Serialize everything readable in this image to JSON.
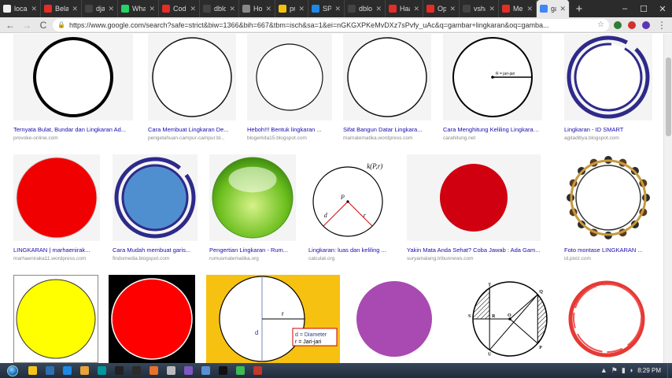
{
  "browser": {
    "tabs": [
      {
        "title": "localho",
        "color": "#f0f0f0"
      },
      {
        "title": "Belajar",
        "color": "#e52d27"
      },
      {
        "title": "django",
        "color": "#444444"
      },
      {
        "title": "Whats",
        "color": "#25d366"
      },
      {
        "title": "Coding",
        "color": "#e52d27"
      },
      {
        "title": "dbloisi",
        "color": "#444444"
      },
      {
        "title": "How to",
        "color": "#888888"
      },
      {
        "title": "profs.",
        "color": "#f4c20d"
      },
      {
        "title": "SPQR",
        "color": "#1e88e5"
      },
      {
        "title": "dbloisi",
        "color": "#444444"
      },
      {
        "title": "Haar C",
        "color": "#e52d27"
      },
      {
        "title": "OpenC",
        "color": "#e52d27"
      },
      {
        "title": "vshant",
        "color": "#444444"
      },
      {
        "title": "Mende",
        "color": "#e52d27"
      },
      {
        "title": "gar",
        "color": "#4285f4",
        "active": true
      }
    ],
    "new_tab_label": "+",
    "window_controls": {
      "minimize": "–",
      "maximize": "☐",
      "close": "✕"
    },
    "nav": {
      "back": "←",
      "forward": "→",
      "reload": "C",
      "home": "⌂"
    },
    "url": "https://www.google.com/search?safe=strict&biw=1366&bih=667&tbm=isch&sa=1&ei=nGKGXPKeMvDXz7sPvfy_uAc&q=gambar+lingkaran&oq=gamba...",
    "star_icon": "☆",
    "extension_colors": [
      "#2e7d32",
      "#d32f2f",
      "#5e35b1"
    ]
  },
  "results": [
    {
      "title": "Ternyata Bulat, Bundar dan Lingkaran Ad...",
      "source": "provoke-online.com",
      "art": "thick-ring"
    },
    {
      "title": "Cara Membuat Lingkaran De...",
      "source": "pengetahuan-campur-campur.bl...",
      "art": "thin-ring"
    },
    {
      "title": "Heboh!!! Bentuk lingkaran ...",
      "source": "blogerkita15.blogspot.com",
      "art": "thin-ring-small"
    },
    {
      "title": "Sifat Bangun Datar Lingkara...",
      "source": "mamatematika.wordpress.com",
      "art": "thin-ring"
    },
    {
      "title": "Cara Menghitung Keliling Lingkaran ...",
      "source": "carahitung.net",
      "art": "radius-circle",
      "label": "R = jari-jari"
    },
    {
      "title": "Lingkaran - ID SMART",
      "source": "agitaditiya.blogspot.com",
      "art": "navy-ring"
    },
    {
      "title": "LINGKARAN | marhaenirak...",
      "source": "marhaeniraka11.wordpress.com",
      "art": "red-disc"
    },
    {
      "title": "Cara Mudah membuat garis...",
      "source": "findomedia.blogspot.com",
      "art": "blue-disc-ring"
    },
    {
      "title": "Pengertian Lingkaran - Rum...",
      "source": "rumusmatematika.org",
      "art": "green-ball"
    },
    {
      "title": "Lingkaran: luas dan keliling ...",
      "source": "calculat.org",
      "art": "kpr-circle",
      "labels": [
        "k(P,r)",
        "P",
        "d",
        "r"
      ]
    },
    {
      "title": "Yakin Mata Anda Sehat? Coba Jawab : Ada Gam...",
      "source": "suryamalang.tribunnews.com",
      "art": "red-disc-dark"
    },
    {
      "title": "Foto montase LINGKARAN ...",
      "source": "id.pixiz.com",
      "art": "ornate-frame"
    },
    {
      "title": "",
      "source": "",
      "art": "yellow-disc"
    },
    {
      "title": "",
      "source": "",
      "art": "red-on-black"
    },
    {
      "title": "",
      "source": "",
      "art": "diameter-diagram",
      "labels": [
        "r",
        "d",
        "d = Diameter",
        "r = Jari-jari"
      ]
    },
    {
      "title": "",
      "source": "",
      "art": "purple-disc"
    },
    {
      "title": "",
      "source": "",
      "art": "parts-diagram",
      "labels": [
        "T",
        "Q",
        "S",
        "R",
        "O",
        "U",
        "P"
      ]
    },
    {
      "title": "",
      "source": "",
      "art": "red-brush-ring"
    }
  ],
  "taskbar": {
    "icon_colors": [
      "#f5c518",
      "#2f6fb0",
      "#1e88e5",
      "#e8a33a",
      "#00979d",
      "#222222",
      "#2b2b2b",
      "#e8712c",
      "#bbbbbb",
      "#7e57c2",
      "#5a8fd6",
      "#111111",
      "#3cba54",
      "#c0392b"
    ],
    "clock": "8:29 PM",
    "tray_symbols": [
      "▲",
      "⚑",
      "▮",
      "◗"
    ]
  }
}
